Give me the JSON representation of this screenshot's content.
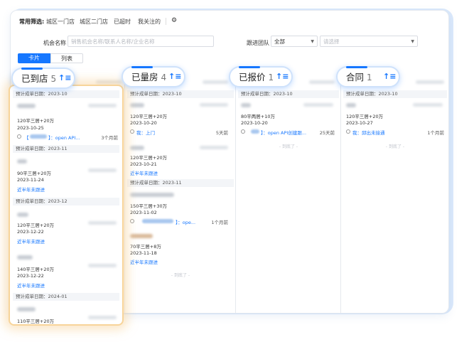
{
  "filter": {
    "label": "常用筛选:",
    "quick": [
      "城区一门店",
      "城区二门店",
      "已超时",
      "我关注的"
    ],
    "gear": "⚙"
  },
  "search": {
    "label": "机会名称",
    "placeholder": "销售机会名称/联系人名称/企业名称",
    "team_label": "跟进团队",
    "team_value": "全部",
    "team_select_placeholder": "请选择"
  },
  "view_tabs": [
    "卡片",
    "列表"
  ],
  "icons": {
    "sort": "sort-ascending-icon",
    "gear": "gear-icon",
    "caret": "chevron-down-icon"
  },
  "accent": "#1677ff",
  "columns": [
    {
      "title": "已到店",
      "count": "5",
      "groups": [
        {
          "date": "预计成单日期：2023-10"
        },
        {
          "date": "预计成单日期：2023-11"
        },
        {
          "date": "预计成单日期：2023-12"
        },
        {
          "date": "预计成单日期：2024-01"
        }
      ],
      "cards": [
        {
          "spec": "120平三居+20万",
          "date": "2023-10-25",
          "note": "】：open API...",
          "ago": "3个月前"
        },
        {
          "spec": "90平三居+20万",
          "date": "2023-11-24",
          "note": "近半年未跟进"
        },
        {
          "spec": "120平三居+20万",
          "date": "2023-12-22",
          "note": "近半年未跟进"
        },
        {
          "spec": "140平三居+20万",
          "date": "2023-12-22",
          "note": "近半年未跟进"
        },
        {
          "spec": "110平三居+20万"
        }
      ]
    },
    {
      "title": "已量房",
      "count": "4",
      "groups": [
        {
          "date": "预计成单日期：2023-10"
        },
        {
          "date": "预计成单日期：2023-11"
        }
      ],
      "cards": [
        {
          "spec": "120平三居+20万",
          "date": "2023-10-20",
          "note": "我：上门",
          "ago": "5天前"
        },
        {
          "spec": "120平三居+20万",
          "date": "2023-10-21",
          "note": "近半年未跟进"
        },
        {
          "spec": "150平三居+30万",
          "date": "2023-11-02",
          "note": "】：ope...",
          "ago": "1个月前"
        },
        {
          "spec": "70平三居+8万",
          "date": "2023-11-18",
          "note": "近半年未跟进"
        }
      ],
      "end": "- 到底了 -"
    },
    {
      "title": "已报价",
      "count": "1",
      "groups": [
        {
          "date": "预计成单日期：2023-10"
        }
      ],
      "cards": [
        {
          "spec": "80平两居+10万",
          "date": "2023-10-20",
          "note": "】：open API创建跟...",
          "ago": "25天前"
        }
      ],
      "end": "- 到底了 -"
    },
    {
      "title": "合同",
      "count": "1",
      "groups": [
        {
          "date": "预计成单日期：2023-10"
        }
      ],
      "cards": [
        {
          "spec": "120平三居+20万",
          "date": "2023-10-27",
          "note": "我：邱出未接通",
          "ago": "1个月前"
        }
      ],
      "end": "- 到底了 -"
    }
  ]
}
